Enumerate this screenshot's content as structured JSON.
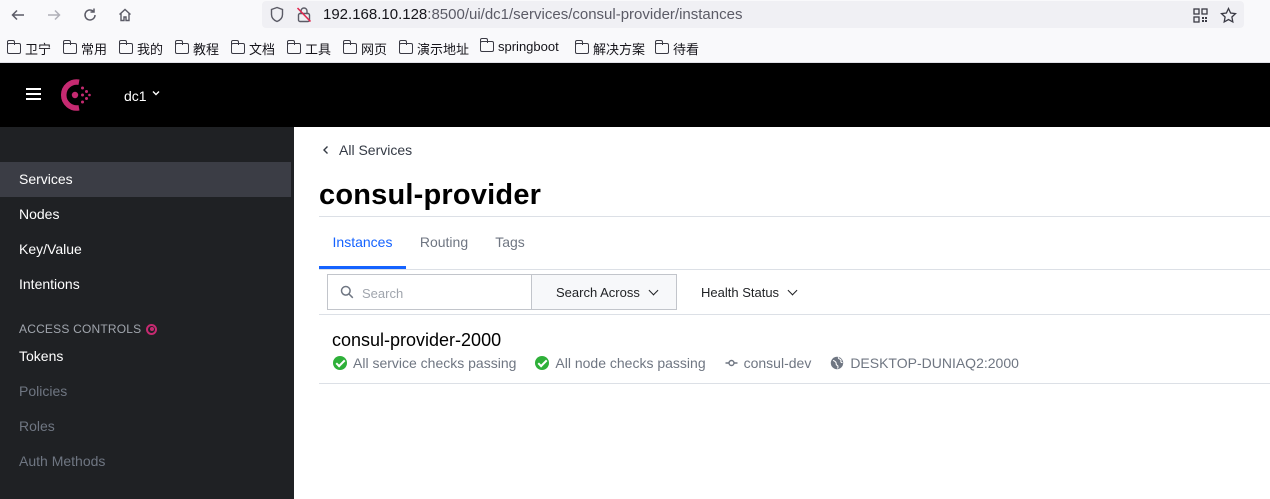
{
  "browser": {
    "url_host": "192.168.10.128",
    "url_rest": ":8500/ui/dc1/services/consul-provider/instances"
  },
  "bookmarks": [
    "卫宁",
    "常用",
    "我的",
    "教程",
    "文档",
    "工具",
    "网页",
    "演示地址",
    "springboot",
    "解决方案",
    "待看"
  ],
  "header": {
    "datacenter": "dc1"
  },
  "sidebar": {
    "items": [
      {
        "label": "Services"
      },
      {
        "label": "Nodes"
      },
      {
        "label": "Key/Value"
      },
      {
        "label": "Intentions"
      }
    ],
    "access_heading": "ACCESS CONTROLS",
    "access_items": [
      {
        "label": "Tokens"
      },
      {
        "label": "Policies"
      },
      {
        "label": "Roles"
      },
      {
        "label": "Auth Methods"
      }
    ]
  },
  "main": {
    "breadcrumb": "All Services",
    "title": "consul-provider",
    "tabs": [
      {
        "label": "Instances"
      },
      {
        "label": "Routing"
      },
      {
        "label": "Tags"
      }
    ],
    "search_placeholder": "Search",
    "search_across": "Search Across",
    "health_status": "Health Status",
    "instance": {
      "name": "consul-provider-2000",
      "service_checks": "All service checks passing",
      "node_checks": "All node checks passing",
      "node": "consul-dev",
      "address": "DESKTOP-DUNIAQ2:2000"
    }
  },
  "colors": {
    "accent": "#1563ff",
    "consul_brand": "#c62a71",
    "passing": "#2eb039",
    "sidebar_bg": "#1f2124"
  }
}
